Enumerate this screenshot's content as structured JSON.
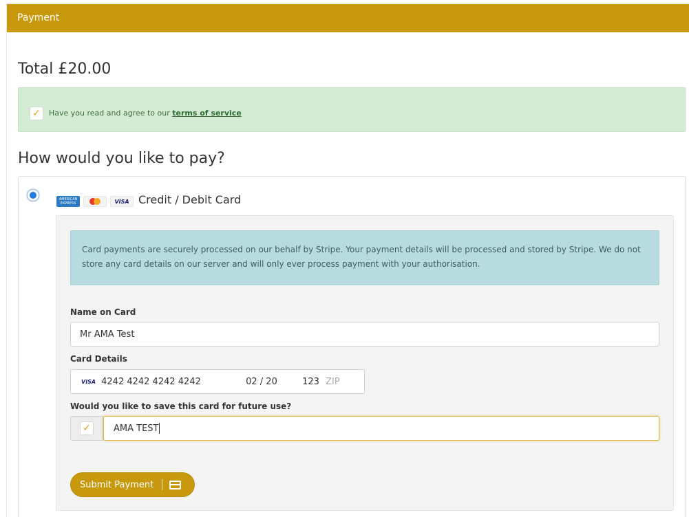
{
  "panel": {
    "header_title": "Payment"
  },
  "total": {
    "text": "Total £20.00"
  },
  "terms": {
    "checked": true,
    "text": "Have you read and agree to our",
    "link_text": "terms of service"
  },
  "payment": {
    "heading": "How would you like to pay?",
    "method": {
      "selected": true,
      "logos": [
        "amex-logo",
        "mastercard-logo",
        "visa-logo"
      ],
      "amex_text": "AMERICAN EXPRESS",
      "visa_text": "VISA",
      "label": "Credit / Debit Card"
    },
    "info_text": "Card payments are securely processed on our behalf by Stripe. Your payment details will be processed and stored by Stripe. We do not store any card details on our server and will only ever process payment with your authorisation.",
    "name_on_card": {
      "label": "Name on Card",
      "value": "Mr AMA Test"
    },
    "card_details": {
      "label": "Card Details",
      "brand": "VISA",
      "number": "4242 4242 4242 4242",
      "expiry": "02 / 20",
      "cvc": "123",
      "zip_placeholder": "ZIP"
    },
    "save_card": {
      "label": "Would you like to save this card for future use?",
      "checked": true,
      "value": "AMA TEST"
    },
    "submit_label": "Submit Payment"
  },
  "colors": {
    "header": "#c8990c",
    "terms_bg": "#d4ecd4",
    "info_bg": "#b7dcdf",
    "check": "#e3a20b",
    "radio": "#1e7be0"
  }
}
